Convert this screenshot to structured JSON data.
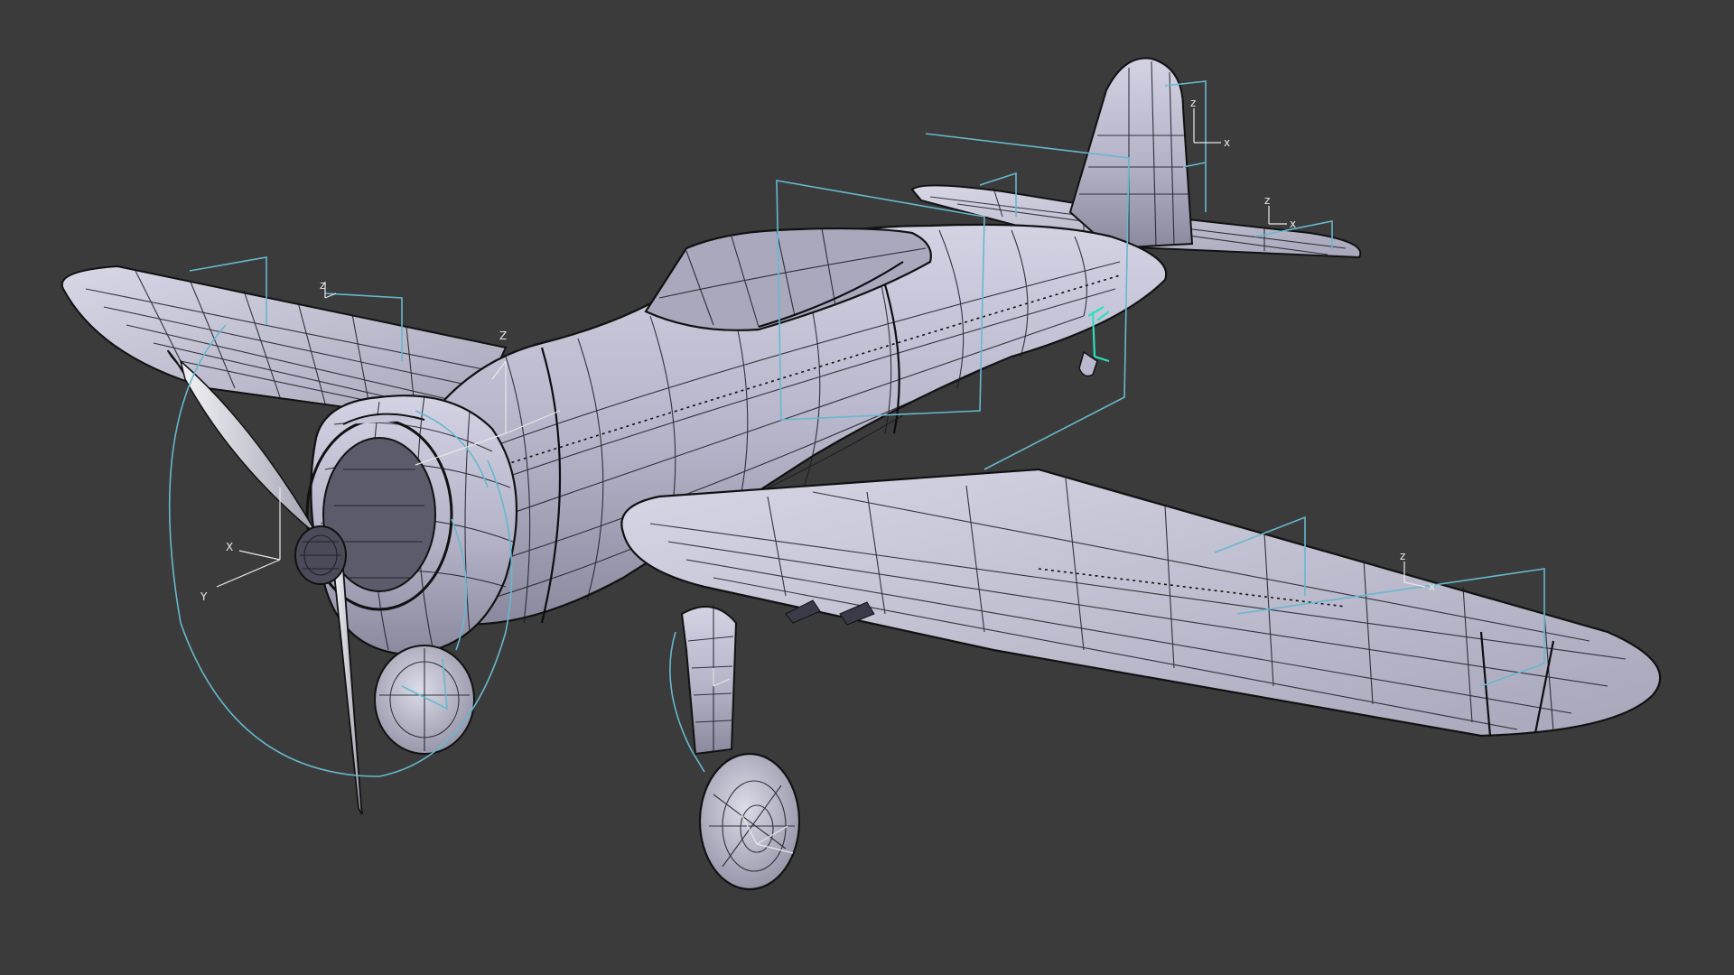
{
  "viewport": {
    "background": "#3b3b3b",
    "surface_color": "#b9b8cc",
    "wire_color": "#1a1a22",
    "guide_color": "#67b8cf",
    "handle_color": "#2de0c0"
  },
  "axis_gizmos": [
    {
      "name": "axis-gizmo-propeller",
      "labels": {
        "x": "X",
        "y": "Y",
        "z": ""
      }
    },
    {
      "name": "axis-gizmo-engine",
      "labels": {
        "x": "",
        "y": "",
        "z": "Z"
      }
    },
    {
      "name": "axis-gizmo-left-wing",
      "labels": {
        "x": "",
        "y": "",
        "z": "z"
      }
    },
    {
      "name": "axis-gizmo-right-wing",
      "labels": {
        "x": "x",
        "y": "",
        "z": "z"
      }
    },
    {
      "name": "axis-gizmo-tail",
      "labels": {
        "x": "x",
        "y": "",
        "z": "z"
      }
    },
    {
      "name": "axis-gizmo-stabilizer",
      "labels": {
        "x": "x",
        "y": "",
        "z": "z"
      }
    },
    {
      "name": "axis-gizmo-landing-gear",
      "labels": {
        "x": "",
        "y": "",
        "z": ""
      }
    }
  ]
}
